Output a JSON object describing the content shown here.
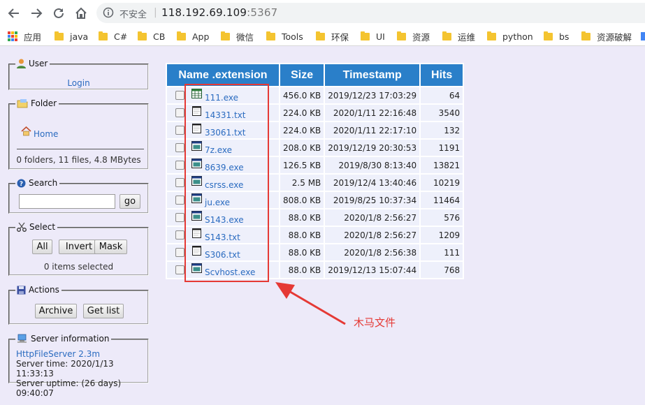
{
  "browser": {
    "security_label": "不安全",
    "url_host": "118.192.69.109",
    "url_port": ":5367",
    "bookmarks": [
      {
        "label": "应用",
        "type": "apps"
      },
      {
        "label": "java",
        "type": "folder"
      },
      {
        "label": "C#",
        "type": "folder"
      },
      {
        "label": "CB",
        "type": "folder"
      },
      {
        "label": "App",
        "type": "folder"
      },
      {
        "label": "微信",
        "type": "folder"
      },
      {
        "label": "Tools",
        "type": "folder"
      },
      {
        "label": "环保",
        "type": "folder"
      },
      {
        "label": "UI",
        "type": "folder"
      },
      {
        "label": "资源",
        "type": "folder"
      },
      {
        "label": "运维",
        "type": "folder"
      },
      {
        "label": "python",
        "type": "folder"
      },
      {
        "label": "bs",
        "type": "folder"
      },
      {
        "label": "资源破解",
        "type": "folder"
      }
    ]
  },
  "sidebar": {
    "user": {
      "title": "User",
      "login_label": "Login"
    },
    "folder": {
      "title": "Folder",
      "home_label": "Home",
      "summary": "0 folders, 11 files, 4.8 MBytes"
    },
    "search": {
      "title": "Search",
      "input_value": "",
      "go_label": "go"
    },
    "select": {
      "title": "Select",
      "all_label": "All",
      "invert_label": "Invert",
      "mask_label": "Mask",
      "status": "0 items selected"
    },
    "actions": {
      "title": "Actions",
      "archive_label": "Archive",
      "getlist_label": "Get list"
    },
    "server": {
      "title": "Server information",
      "software": "HttpFileServer 2.3m",
      "time": "Server time: 2020/1/13 11:33:13",
      "uptime": "Server uptime: (26 days) 09:40:07"
    }
  },
  "table": {
    "headers": {
      "name": "Name .extension",
      "size": "Size",
      "timestamp": "Timestamp",
      "hits": "Hits"
    },
    "rows": [
      {
        "name": "111.exe",
        "size": "456.0 KB",
        "timestamp": "2019/12/23 17:03:29",
        "hits": "64",
        "icon": "spreadsheet-icon"
      },
      {
        "name": "14331.txt",
        "size": "224.0 KB",
        "timestamp": "2020/1/11 22:16:48",
        "hits": "3540",
        "icon": "text-file-icon"
      },
      {
        "name": "33061.txt",
        "size": "224.0 KB",
        "timestamp": "2020/1/11 22:17:10",
        "hits": "132",
        "icon": "text-file-icon"
      },
      {
        "name": "7z.exe",
        "size": "208.0 KB",
        "timestamp": "2019/12/19 20:30:53",
        "hits": "1191",
        "icon": "application-icon"
      },
      {
        "name": "8639.exe",
        "size": "126.5 KB",
        "timestamp": "2019/8/30 8:13:40",
        "hits": "13821",
        "icon": "application-icon"
      },
      {
        "name": "csrss.exe",
        "size": "2.5 MB",
        "timestamp": "2019/12/4 13:40:46",
        "hits": "10219",
        "icon": "application-icon"
      },
      {
        "name": "ju.exe",
        "size": "808.0 KB",
        "timestamp": "2019/8/25 10:37:34",
        "hits": "11464",
        "icon": "application-icon"
      },
      {
        "name": "S143.exe",
        "size": "88.0 KB",
        "timestamp": "2020/1/8 2:56:27",
        "hits": "576",
        "icon": "application-icon"
      },
      {
        "name": "S143.txt",
        "size": "88.0 KB",
        "timestamp": "2020/1/8 2:56:27",
        "hits": "1209",
        "icon": "text-file-icon"
      },
      {
        "name": "S306.txt",
        "size": "88.0 KB",
        "timestamp": "2020/1/8 2:56:38",
        "hits": "111",
        "icon": "text-file-icon"
      },
      {
        "name": "Scvhost.exe",
        "size": "88.0 KB",
        "timestamp": "2019/12/13 15:07:44",
        "hits": "768",
        "icon": "application-icon"
      }
    ]
  },
  "annotation": {
    "text": "木马文件",
    "color": "#e53935"
  },
  "colors": {
    "header_blue": "#2a7fc9",
    "link_blue": "#2a6bc0",
    "page_bg": "#edeaf9"
  }
}
